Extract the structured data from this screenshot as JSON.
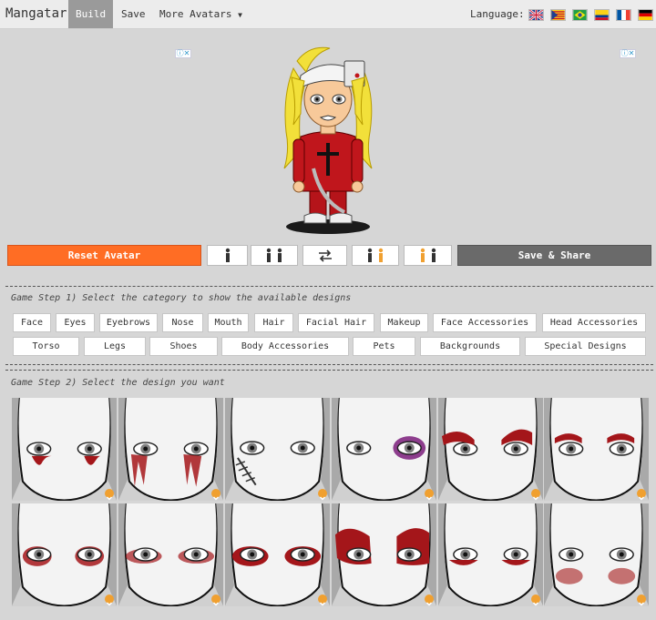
{
  "app": {
    "brand": "Mangatar",
    "nav": {
      "build": "Build",
      "save": "Save",
      "more": "More Avatars"
    },
    "language_label": "Language:"
  },
  "languages": [
    {
      "name": "english-flag",
      "colors": [
        "#1f3f8f",
        "#ffffff",
        "#c8102e"
      ]
    },
    {
      "name": "catalan-flag",
      "colors": [
        "#f6d21b",
        "#c8102e",
        "#1f3f8f"
      ]
    },
    {
      "name": "portuguese-brazil-flag",
      "colors": [
        "#229e45",
        "#f8e509",
        "#2b49a3"
      ]
    },
    {
      "name": "spanish-colombia-flag",
      "colors": [
        "#fcd116",
        "#003893",
        "#ce1126"
      ]
    },
    {
      "name": "french-flag",
      "colors": [
        "#0055a4",
        "#ffffff",
        "#ef4135"
      ]
    },
    {
      "name": "german-flag",
      "colors": [
        "#000000",
        "#dd0000",
        "#ffce00"
      ]
    }
  ],
  "controls": {
    "reset": "Reset Avatar",
    "share": "Save & Share"
  },
  "step1": {
    "title": "Game Step 1) Select the category to show the available designs",
    "row1": [
      "Face",
      "Eyes",
      "Eyebrows",
      "Nose",
      "Mouth",
      "Hair",
      "Facial Hair",
      "Makeup",
      "Face Accessories",
      "Head Accessories"
    ],
    "row2": [
      "Torso",
      "Legs",
      "Shoes",
      "Body Accessories",
      "Pets",
      "Backgrounds",
      "Special Designs"
    ]
  },
  "step2": {
    "title": "Game Step 2) Select the design you want"
  },
  "colors": {
    "accent": "#ff6d24",
    "share": "#6a6a6a",
    "blood": "#a4161a",
    "tile_chevron": "#f0a030"
  }
}
